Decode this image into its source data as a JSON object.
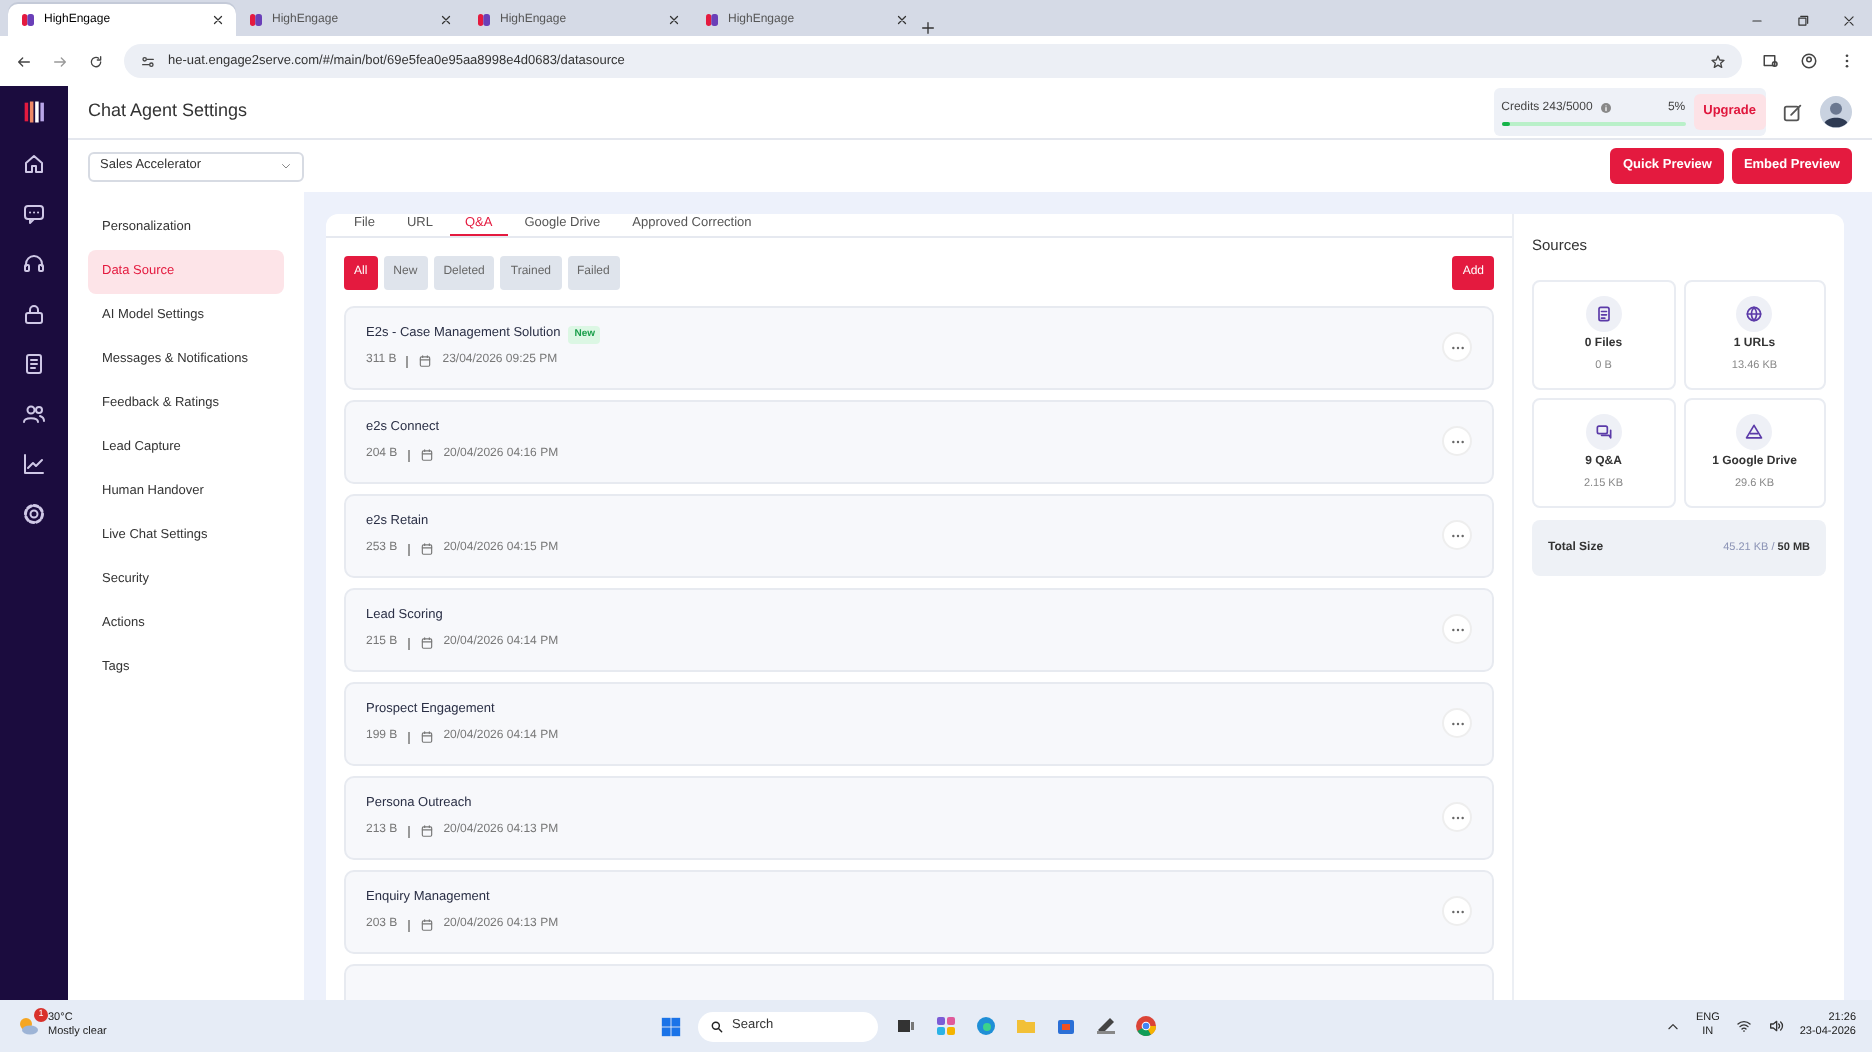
{
  "browser": {
    "tabs": [
      {
        "title": "HighEngage",
        "selected": true
      },
      {
        "title": "HighEngage",
        "selected": false
      },
      {
        "title": "HighEngage",
        "selected": false
      },
      {
        "title": "HighEngage",
        "selected": false
      }
    ],
    "url": "he-uat.engage2serve.com/#/main/bot/69e5fea0e95aa8998e4d0683/datasource"
  },
  "header": {
    "title": "Chat Agent Settings",
    "credits_label": "Credits 243/5000",
    "percent": "5%",
    "level": 0.05,
    "upgrade": "Upgrade"
  },
  "agent_select": {
    "value": "Sales Accelerator"
  },
  "actions": [
    "Quick Preview",
    "Embed Preview"
  ],
  "menu": [
    {
      "label": "Personalization",
      "selected": false
    },
    {
      "label": "Data Source",
      "selected": true
    },
    {
      "label": "AI Model Settings",
      "selected": false
    },
    {
      "label": "Messages & Notifications",
      "selected": false
    },
    {
      "label": "Feedback & Ratings",
      "selected": false
    },
    {
      "label": "Lead Capture",
      "selected": false
    },
    {
      "label": "Human Handover",
      "selected": false
    },
    {
      "label": "Live Chat Settings",
      "selected": false
    },
    {
      "label": "Security",
      "selected": false
    },
    {
      "label": "Actions",
      "selected": false
    },
    {
      "label": "Tags",
      "selected": false
    }
  ],
  "source_tabs": [
    {
      "label": "File",
      "selected": false
    },
    {
      "label": "URL",
      "selected": false
    },
    {
      "label": "Q&A",
      "selected": true
    },
    {
      "label": "Google Drive",
      "selected": false
    },
    {
      "label": "Approved Correction",
      "selected": false
    }
  ],
  "filters": [
    {
      "label": "All",
      "selected": true
    },
    {
      "label": "New",
      "selected": false
    },
    {
      "label": "Deleted",
      "selected": false
    },
    {
      "label": "Trained",
      "selected": false
    },
    {
      "label": "Failed",
      "selected": false
    }
  ],
  "add_button": "Add",
  "qa_items": [
    {
      "title": "E2s - Case Management Solution",
      "badge": "New",
      "size": "311 B",
      "date": "23/04/2026 09:25 PM"
    },
    {
      "title": "e2s Connect",
      "size": "204 B",
      "date": "20/04/2026 04:16 PM"
    },
    {
      "title": "e2s Retain",
      "size": "253 B",
      "date": "20/04/2026 04:15 PM"
    },
    {
      "title": "Lead Scoring",
      "size": "215 B",
      "date": "20/04/2026 04:14 PM"
    },
    {
      "title": "Prospect Engagement",
      "size": "199 B",
      "date": "20/04/2026 04:14 PM"
    },
    {
      "title": "Persona Outreach",
      "size": "213 B",
      "date": "20/04/2026 04:13 PM"
    },
    {
      "title": "Enquiry Management",
      "size": "203 B",
      "date": "20/04/2026 04:13 PM"
    }
  ],
  "sources": {
    "title": "Sources",
    "cards": [
      {
        "kind": "files",
        "count": "0 Files",
        "size": "0 B"
      },
      {
        "kind": "urls",
        "count": "1 URLs",
        "size": "13.46 KB"
      },
      {
        "kind": "qa",
        "count": "9 Q&A",
        "size": "2.15 KB"
      },
      {
        "kind": "drive",
        "count": "1 Google Drive",
        "size": "29.6 KB"
      }
    ],
    "total": {
      "label": "Total Size",
      "value": "45.21 KB / **50 MB**"
    }
  },
  "taskbar": {
    "temp": "30°C",
    "condition": "Mostly clear",
    "badge": "1",
    "search": "Search",
    "lang": "ENG",
    "region": "IN",
    "time": "21:26",
    "date": "23-04-2026"
  }
}
